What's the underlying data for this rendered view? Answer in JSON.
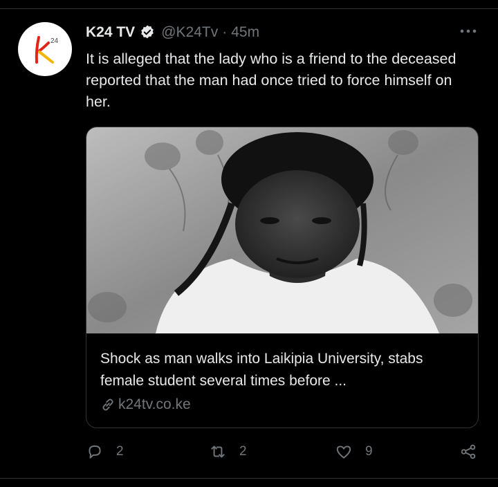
{
  "author": {
    "name": "K24 TV",
    "handle": "@K24Tv",
    "separator": "·",
    "time": "45m",
    "avatar_text": "k",
    "avatar_sup": "24"
  },
  "tweet": {
    "text": "It is alleged that the lady who is a friend to the deceased reported that the man had once tried to force himself on her."
  },
  "card": {
    "title": "Shock as man walks into Laikipia University, stabs female student several times before ...",
    "domain": "k24tv.co.ke"
  },
  "actions": {
    "reply_count": "2",
    "retweet_count": "2",
    "like_count": "9"
  },
  "icons": [
    "verified-icon",
    "more-icon",
    "link-icon",
    "reply-icon",
    "retweet-icon",
    "like-icon",
    "share-icon"
  ],
  "colors": {
    "background": "#000000",
    "text": "#e7e9ea",
    "muted": "#71767b",
    "logo_red": "#e2231a",
    "logo_yellow": "#f5b400"
  }
}
